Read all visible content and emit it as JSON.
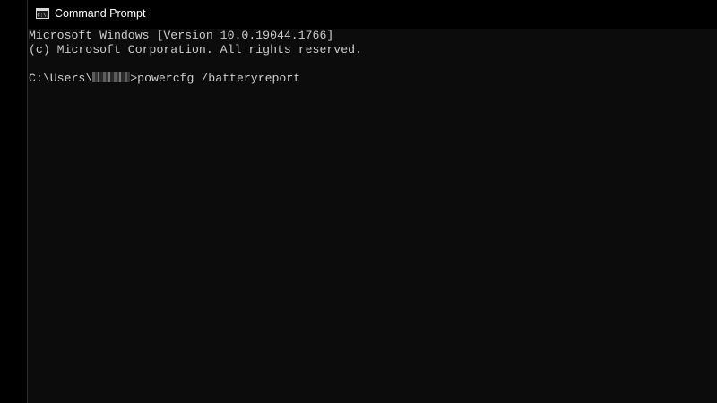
{
  "window": {
    "title": "Command Prompt",
    "icon": "cmd-icon",
    "icon_text": "C:\\."
  },
  "console": {
    "lines": [
      "Microsoft Windows [Version 10.0.19044.1766]",
      "(c) Microsoft Corporation. All rights reserved.",
      ""
    ],
    "prompt_prefix": "C:\\Users\\",
    "prompt_suffix": ">",
    "command": "powercfg /batteryreport"
  },
  "colors": {
    "console_background": "#0c0c0c",
    "console_text": "#cccccc",
    "titlebar_background": "#000000",
    "title_text": "#ffffff"
  }
}
